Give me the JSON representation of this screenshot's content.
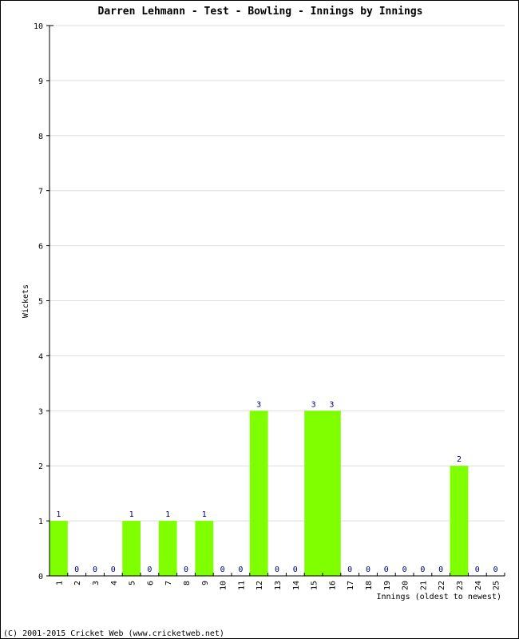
{
  "chart_data": {
    "type": "bar",
    "title": "Darren Lehmann - Test - Bowling - Innings by Innings",
    "xlabel": "Innings (oldest to newest)",
    "ylabel": "Wickets",
    "ylim": [
      0,
      10
    ],
    "yticks": [
      0,
      1,
      2,
      3,
      4,
      5,
      6,
      7,
      8,
      9,
      10
    ],
    "categories": [
      "1",
      "2",
      "3",
      "4",
      "5",
      "6",
      "7",
      "8",
      "9",
      "10",
      "11",
      "12",
      "13",
      "14",
      "15",
      "16",
      "17",
      "18",
      "19",
      "20",
      "21",
      "22",
      "23",
      "24",
      "25"
    ],
    "values": [
      1,
      0,
      0,
      0,
      1,
      0,
      1,
      0,
      1,
      0,
      0,
      3,
      0,
      0,
      3,
      3,
      0,
      0,
      0,
      0,
      0,
      0,
      2,
      0,
      0
    ],
    "grid": true,
    "bar_color": "#80ff00",
    "label_color": "#000080",
    "grid_color": "#dddddd"
  },
  "footer": "(C) 2001-2015 Cricket Web (www.cricketweb.net)"
}
